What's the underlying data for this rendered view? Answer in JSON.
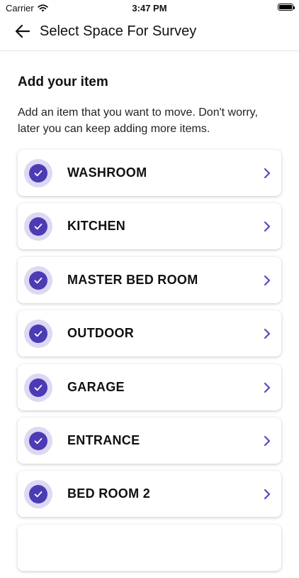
{
  "status_bar": {
    "carrier": "Carrier",
    "time": "3:47 PM",
    "wifi_icon": "wifi-icon",
    "battery_icon": "battery-icon"
  },
  "nav": {
    "back_icon": "arrow-left-icon",
    "title": "Select Space For Survey"
  },
  "section": {
    "title": "Add your item",
    "description": "Add an item that you want to move. Don't worry, later you can keep adding more items."
  },
  "spaces": [
    {
      "label": "WASHROOM",
      "checked": true
    },
    {
      "label": "KITCHEN",
      "checked": true
    },
    {
      "label": "MASTER BED ROOM",
      "checked": true
    },
    {
      "label": "OUTDOOR",
      "checked": true
    },
    {
      "label": "GARAGE",
      "checked": true
    },
    {
      "label": "ENTRANCE",
      "checked": true
    },
    {
      "label": "BED ROOM 2",
      "checked": true
    }
  ],
  "colors": {
    "accent": "#4b3bb4",
    "accent_light": "#ddd8f3",
    "chevron": "#5a48c0"
  }
}
